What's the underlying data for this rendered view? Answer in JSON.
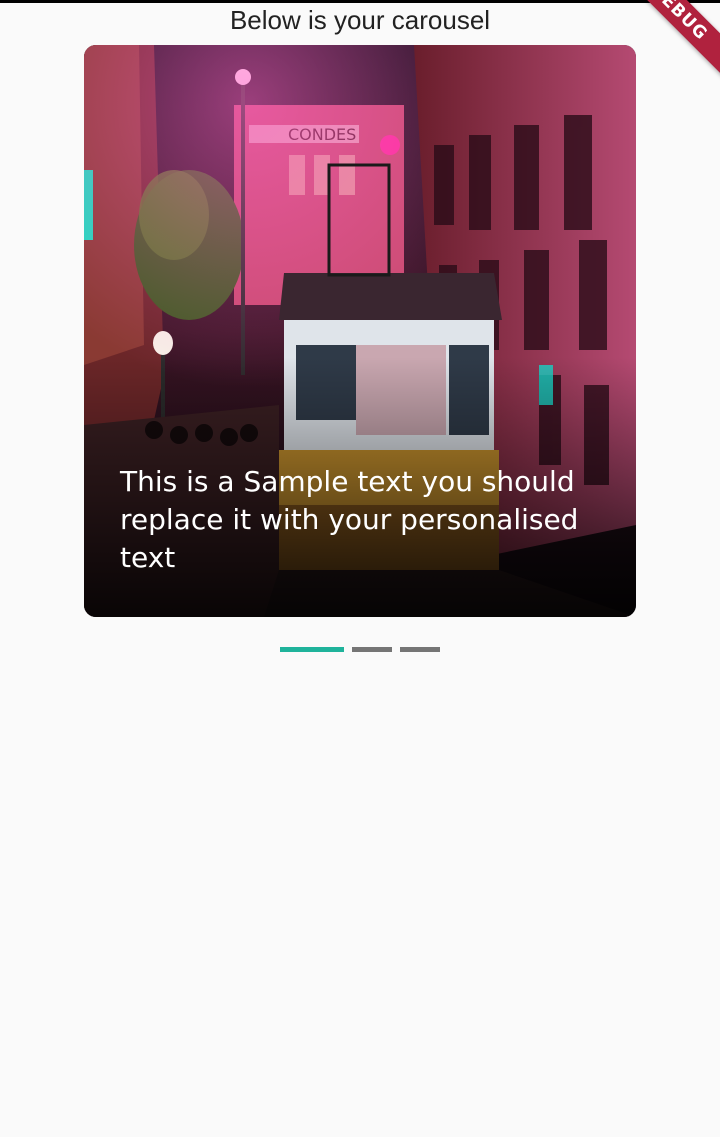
{
  "page": {
    "title": "Below is your carousel"
  },
  "debug_banner": {
    "label": "DEBUG"
  },
  "carousel": {
    "slides": [
      {
        "caption": "This is a Sample text you should replace it with your personalised text"
      }
    ],
    "active_index": 0,
    "indicator_count": 3
  },
  "colors": {
    "indicator_active": "#1fb39b",
    "indicator_inactive": "#757575",
    "debug_banner": "#b0223e",
    "background": "#fafafa"
  },
  "icons": {
    "image": "night-tram-street-photo"
  }
}
